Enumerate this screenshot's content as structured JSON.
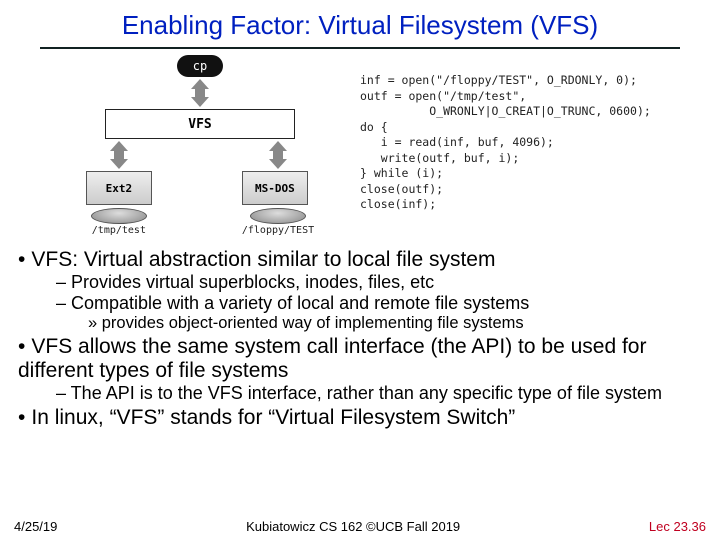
{
  "title": "Enabling Factor: Virtual Filesystem (VFS)",
  "diagram": {
    "cp": "cp",
    "vfs": "VFS",
    "fs": [
      "Ext2",
      "MS-DOS"
    ],
    "paths": [
      "/tmp/test",
      "/floppy/TEST"
    ]
  },
  "code": "inf = open(\"/floppy/TEST\", O_RDONLY, 0);\noutf = open(\"/tmp/test\",\n          O_WRONLY|O_CREAT|O_TRUNC, 0600);\ndo {\n   i = read(inf, buf, 4096);\n   write(outf, buf, i);\n} while (i);\nclose(outf);\nclose(inf);",
  "bullets": {
    "p1": "VFS: Virtual abstraction similar to local file system",
    "p1a": "– Provides virtual superblocks, inodes, files, etc",
    "p1b": "– Compatible with a variety of local and remote file systems",
    "p1b1": "» provides object-oriented way of implementing file systems",
    "p2": "VFS allows the same system call interface (the API) to be used for different types of file systems",
    "p2a": "– The API is to the VFS interface, rather than any specific type of file system",
    "p3": "In linux, “VFS” stands for “Virtual Filesystem Switch”"
  },
  "footer": {
    "date": "4/25/19",
    "mid": "Kubiatowicz CS 162 ©UCB Fall 2019",
    "lec": "Lec 23.36"
  }
}
